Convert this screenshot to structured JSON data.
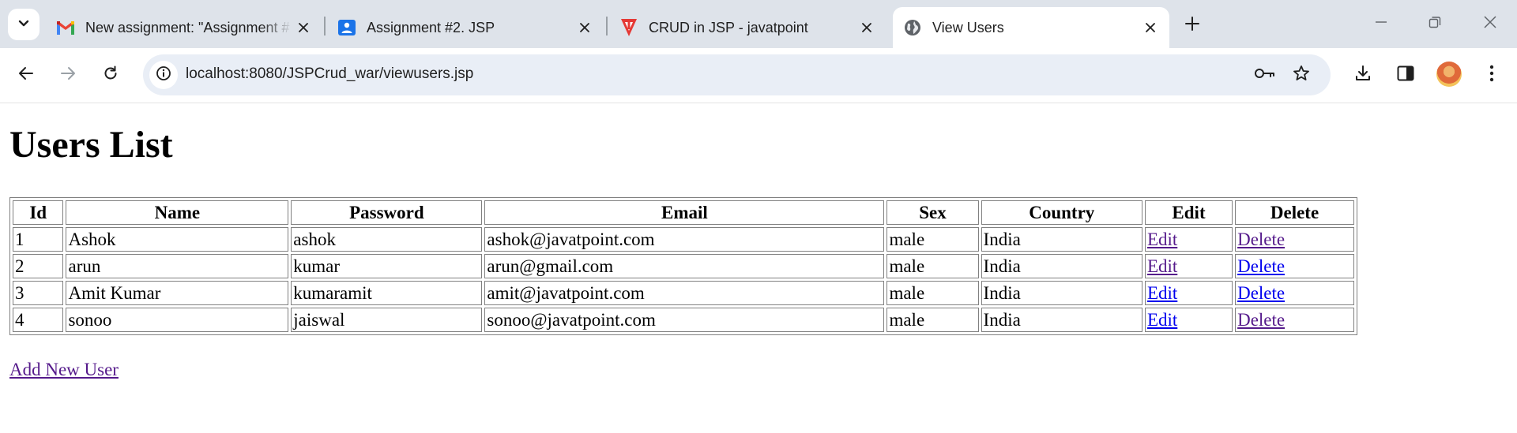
{
  "browser": {
    "tabs": [
      {
        "title": "New assignment: \"Assignment #",
        "icon": "gmail-icon",
        "active": false
      },
      {
        "title": "Assignment #2. JSP",
        "icon": "classroom-icon",
        "active": false
      },
      {
        "title": "CRUD in JSP - javatpoint",
        "icon": "javatpoint-icon",
        "active": false
      },
      {
        "title": "View Users",
        "icon": "globe-icon",
        "active": true
      }
    ],
    "url": "localhost:8080/JSPCrud_war/viewusers.jsp",
    "colors": {
      "tabstrip": "#dee3ea",
      "omnibox": "#e9eef6",
      "visited_link": "#551a8b",
      "link": "#0000ee"
    }
  },
  "page": {
    "heading": "Users List",
    "columns": [
      "Id",
      "Name",
      "Password",
      "Email",
      "Sex",
      "Country",
      "Edit",
      "Delete"
    ],
    "rows": [
      {
        "id": "1",
        "name": "Ashok",
        "password": "ashok",
        "email": "ashok@javatpoint.com",
        "sex": "male",
        "country": "India",
        "edit": "Edit",
        "delete": "Delete",
        "edit_visited": true,
        "delete_visited": true
      },
      {
        "id": "2",
        "name": "arun",
        "password": "kumar",
        "email": "arun@gmail.com",
        "sex": "male",
        "country": "India",
        "edit": "Edit",
        "delete": "Delete",
        "edit_visited": true,
        "delete_visited": false
      },
      {
        "id": "3",
        "name": "Amit Kumar",
        "password": "kumaramit",
        "email": "amit@javatpoint.com",
        "sex": "male",
        "country": "India",
        "edit": "Edit",
        "delete": "Delete",
        "edit_visited": false,
        "delete_visited": false
      },
      {
        "id": "4",
        "name": "sonoo",
        "password": "jaiswal",
        "email": "sonoo@javatpoint.com",
        "sex": "male",
        "country": "India",
        "edit": "Edit",
        "delete": "Delete",
        "edit_visited": false,
        "delete_visited": true
      }
    ],
    "add_new_label": "Add New User"
  }
}
